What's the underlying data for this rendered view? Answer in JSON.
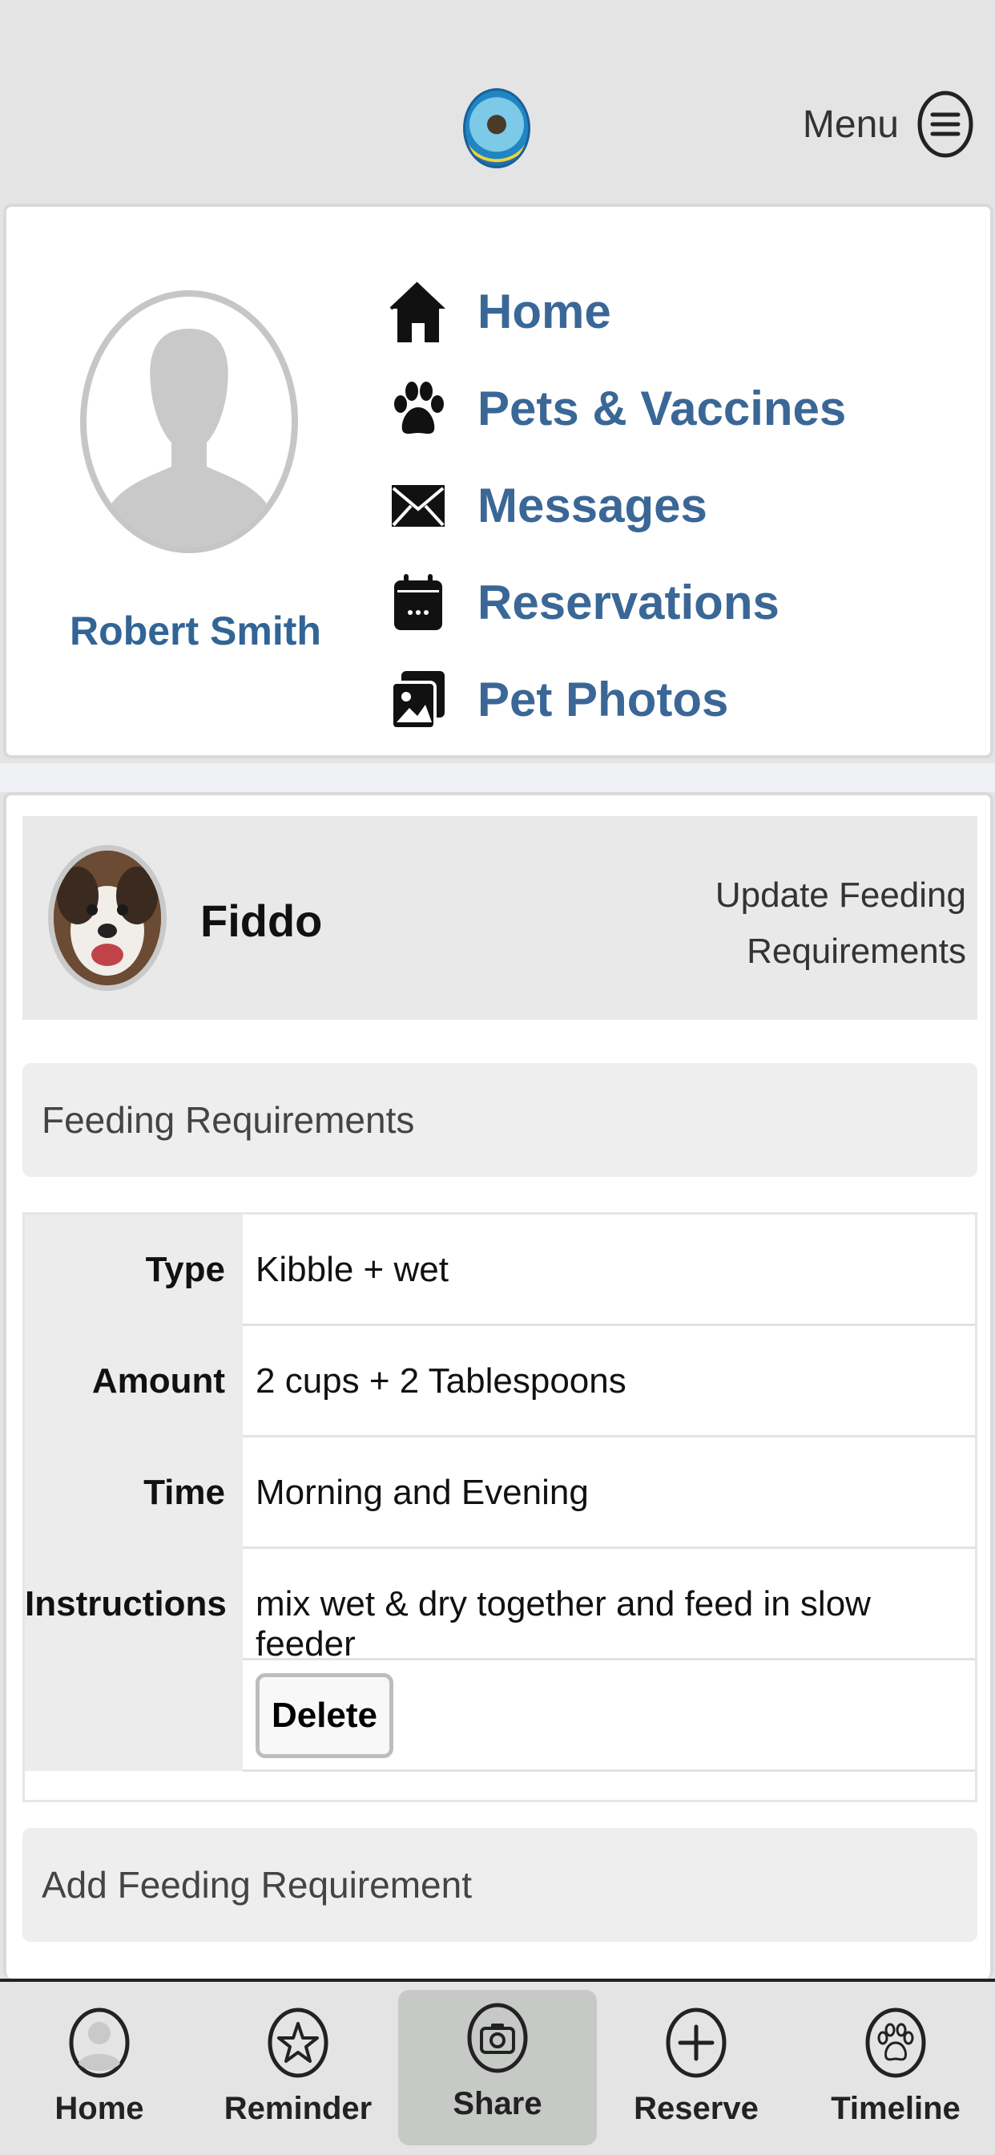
{
  "header": {
    "menu_label": "Menu",
    "logo_icon": "dog-logo",
    "menu_icon": "hamburger-circle-icon"
  },
  "profile": {
    "name": "Robert Smith",
    "avatar_icon": "person-silhouette"
  },
  "nav": {
    "items": [
      {
        "label": "Home",
        "icon": "house-icon"
      },
      {
        "label": "Pets & Vaccines",
        "icon": "paw-icon"
      },
      {
        "label": "Messages",
        "icon": "envelope-icon"
      },
      {
        "label": "Reservations",
        "icon": "calendar-icon"
      },
      {
        "label": "Pet Photos",
        "icon": "photos-icon"
      }
    ]
  },
  "pet": {
    "name": "Fiddo",
    "update_link": "Update Feeding Requirements"
  },
  "feeding": {
    "section_title": "Feeding Requirements",
    "rows": [
      {
        "label": "Type",
        "value": "Kibble + wet"
      },
      {
        "label": "Amount",
        "value": "2 cups + 2 Tablespoons"
      },
      {
        "label": "Time",
        "value": "Morning and Evening"
      },
      {
        "label": "Instructions",
        "value": "mix wet & dry together and feed in slow feeder"
      }
    ],
    "delete_label": "Delete",
    "add_label": "Add Feeding Requirement"
  },
  "bottom_nav": {
    "tabs": [
      {
        "label": "Home",
        "icon": "person-circle-icon"
      },
      {
        "label": "Reminder",
        "icon": "star-circle-icon"
      },
      {
        "label": "Share",
        "icon": "camera-circle-icon",
        "active": true
      },
      {
        "label": "Reserve",
        "icon": "plus-circle-icon"
      },
      {
        "label": "Timeline",
        "icon": "paw-circle-icon"
      }
    ]
  },
  "colors": {
    "link_blue": "#3a6796",
    "background": "#e4e4e4",
    "active_tab": "#c6c9c6"
  }
}
